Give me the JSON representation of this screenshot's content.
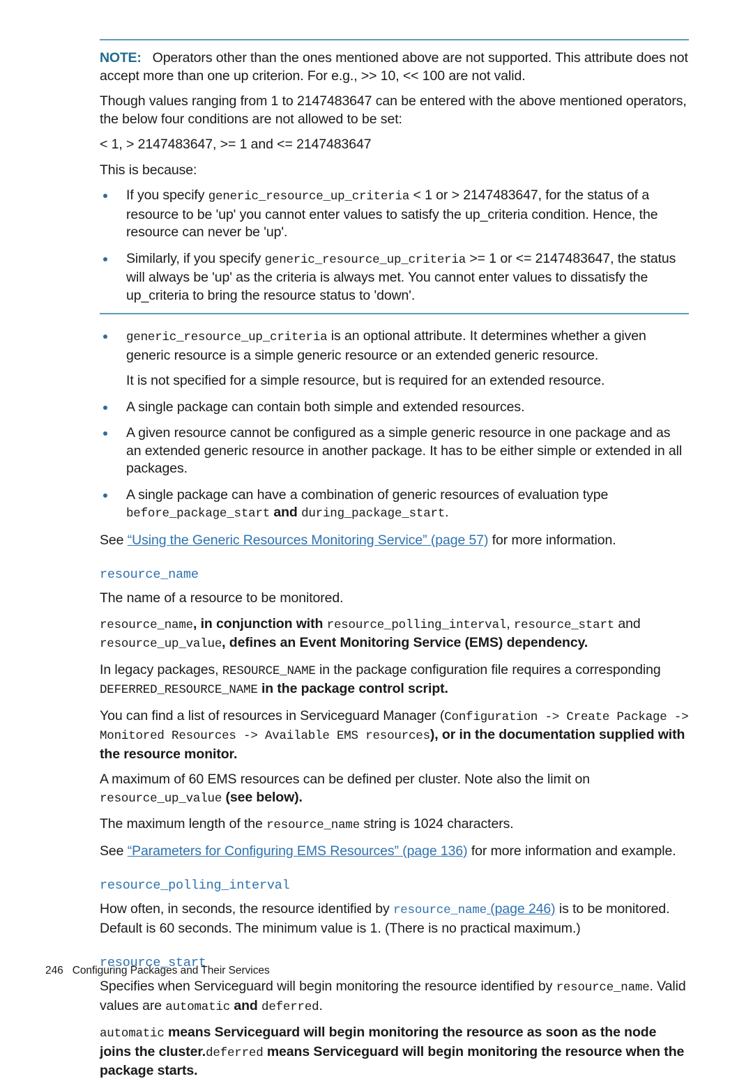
{
  "page": {
    "number": "246",
    "footer_title": "Configuring Packages and Their Services"
  },
  "colors": {
    "note_label": "#1f6a8c",
    "note_rule": "#5b9bb5",
    "link": "#2f72b0",
    "heading": "#2f72b0",
    "bullet": "#2f6b9a",
    "body_text": "#1a1a1a",
    "background": "#ffffff"
  },
  "note": {
    "label": "NOTE:",
    "paragraphs": [
      {
        "parts": [
          {
            "t": "Operators other than the ones mentioned above are not supported. This attribute does not accept more than one up criterion. For e.g., >> 10, << 100 are not valid.",
            "style": "normal"
          }
        ]
      },
      {
        "parts": [
          {
            "t": "Though values ranging from 1 to 2147483647 can be entered with the above mentioned operators, the below four conditions are not allowed to be set:",
            "style": "normal"
          }
        ]
      },
      {
        "parts": [
          {
            "t": "< 1, > 2147483647, >= 1 and <= 2147483647",
            "style": "normal"
          }
        ]
      },
      {
        "parts": [
          {
            "t": "This is because:",
            "style": "normal"
          }
        ]
      }
    ],
    "bullets": [
      {
        "parts": [
          {
            "t": "If you specify ",
            "style": "normal"
          },
          {
            "t": "generic_resource_up_criteria",
            "style": "mono"
          },
          {
            "t": " < 1 or > 2147483647, for the status of a resource to be 'up' you cannot enter values to satisfy the up_criteria condition. Hence, the resource can never be 'up'.",
            "style": "normal"
          }
        ]
      },
      {
        "parts": [
          {
            "t": "Similarly, if you specify ",
            "style": "normal"
          },
          {
            "t": "generic_resource_up_criteria",
            "style": "mono"
          },
          {
            "t": " >= 1 or <= 2147483647, the status will always be 'up' as the criteria is always met. You cannot enter values to dissatisfy the up_criteria to bring the resource status to 'down'.",
            "style": "normal"
          }
        ]
      }
    ]
  },
  "main_bullets": [
    {
      "parts": [
        {
          "t": "generic_resource_up_criteria",
          "style": "mono"
        },
        {
          "t": " is an optional attribute. It determines whether a given generic resource is a simple generic resource or an extended generic resource.",
          "style": "normal"
        }
      ],
      "sub": [
        {
          "t": "It is not specified for a simple resource, but is required for an extended resource.",
          "style": "normal"
        }
      ]
    },
    {
      "parts": [
        {
          "t": "A single package can contain both simple and extended resources.",
          "style": "normal"
        }
      ],
      "sub": []
    },
    {
      "parts": [
        {
          "t": "A given resource cannot be configured as a simple generic resource in one package and as an extended generic resource in another package. It has to be either simple or extended in all packages.",
          "style": "normal"
        }
      ],
      "sub": []
    },
    {
      "parts": [
        {
          "t": "A single package can have a combination of generic resources of evaluation type ",
          "style": "normal"
        },
        {
          "t": "before_package_start",
          "style": "mono"
        },
        {
          "t": " and ",
          "style": "bold"
        },
        {
          "t": "during_package_start",
          "style": "mono"
        },
        {
          "t": ".",
          "style": "normal"
        }
      ],
      "sub": []
    }
  ],
  "see_generic": {
    "prefix": "See ",
    "link": "“Using the Generic Resources Monitoring Service” (page 57)",
    "suffix": " for more information."
  },
  "sections": [
    {
      "heading": "resource_name",
      "paragraphs": [
        {
          "parts": [
            {
              "t": "The name of a resource to be monitored.",
              "style": "normal"
            }
          ]
        },
        {
          "parts": [
            {
              "t": "resource_name",
              "style": "mono"
            },
            {
              "t": ", in conjunction with ",
              "style": "bold"
            },
            {
              "t": "resource_polling_interval",
              "style": "mono"
            },
            {
              "t": ", ",
              "style": "normal"
            },
            {
              "t": "resource_start",
              "style": "mono"
            },
            {
              "t": " and ",
              "style": "normal"
            },
            {
              "t": "resource_up_value",
              "style": "mono"
            },
            {
              "t": ", defines an Event Monitoring Service (EMS) dependency.",
              "style": "bold"
            }
          ]
        },
        {
          "parts": [
            {
              "t": "In legacy packages, ",
              "style": "normal"
            },
            {
              "t": "RESOURCE_NAME",
              "style": "mono"
            },
            {
              "t": " in the package configuration file requires a corresponding ",
              "style": "normal"
            },
            {
              "t": "DEFERRED_RESOURCE_NAME",
              "style": "mono"
            },
            {
              "t": " in the package control script.",
              "style": "bold"
            }
          ]
        },
        {
          "parts": [
            {
              "t": "You can find a list of resources in Serviceguard Manager (",
              "style": "normal"
            },
            {
              "t": "Configuration -> Create Package -> Monitored Resources -> Available EMS resources",
              "style": "mono"
            },
            {
              "t": "), or in the documentation supplied with the resource monitor.",
              "style": "bold"
            }
          ]
        },
        {
          "parts": [
            {
              "t": "A maximum of 60 EMS resources can be defined per cluster. Note also the limit on ",
              "style": "normal"
            },
            {
              "t": "resource_up_value",
              "style": "mono"
            },
            {
              "t": " (see below).",
              "style": "bold"
            }
          ]
        },
        {
          "parts": [
            {
              "t": "The maximum length of the ",
              "style": "normal"
            },
            {
              "t": "resource_name",
              "style": "mono"
            },
            {
              "t": " string is 1024 characters.",
              "style": "normal"
            }
          ]
        },
        {
          "parts": [
            {
              "t": "See ",
              "style": "normal"
            },
            {
              "t": "“Parameters for Configuring EMS Resources” (page 136)",
              "style": "link"
            },
            {
              "t": " for more information and example.",
              "style": "normal"
            }
          ]
        }
      ]
    },
    {
      "heading": "resource_polling_interval",
      "paragraphs": [
        {
          "parts": [
            {
              "t": "How often, in seconds, the resource identified by ",
              "style": "normal"
            },
            {
              "t": "resource_name",
              "style": "link-mono"
            },
            {
              "t": " (page 246)",
              "style": "link"
            },
            {
              "t": " is to be monitored. Default is 60 seconds. The minimum value is 1. (There is no practical maximum.)",
              "style": "normal"
            }
          ]
        }
      ]
    },
    {
      "heading": "resource_start",
      "paragraphs": [
        {
          "parts": [
            {
              "t": "Specifies when Serviceguard will begin monitoring the resource identified by ",
              "style": "normal"
            },
            {
              "t": "resource_name",
              "style": "mono"
            },
            {
              "t": ". Valid values are ",
              "style": "normal"
            },
            {
              "t": "automatic",
              "style": "mono"
            },
            {
              "t": " and ",
              "style": "bold"
            },
            {
              "t": "deferred",
              "style": "mono"
            },
            {
              "t": ".",
              "style": "normal"
            }
          ]
        },
        {
          "parts": [
            {
              "t": "automatic",
              "style": "mono"
            },
            {
              "t": " means Serviceguard will begin monitoring the resource as soon as the node joins the cluster.",
              "style": "bold"
            },
            {
              "t": "deferred",
              "style": "mono"
            },
            {
              "t": " means Serviceguard will begin monitoring the resource when the package starts.",
              "style": "bold"
            }
          ]
        }
      ]
    }
  ]
}
